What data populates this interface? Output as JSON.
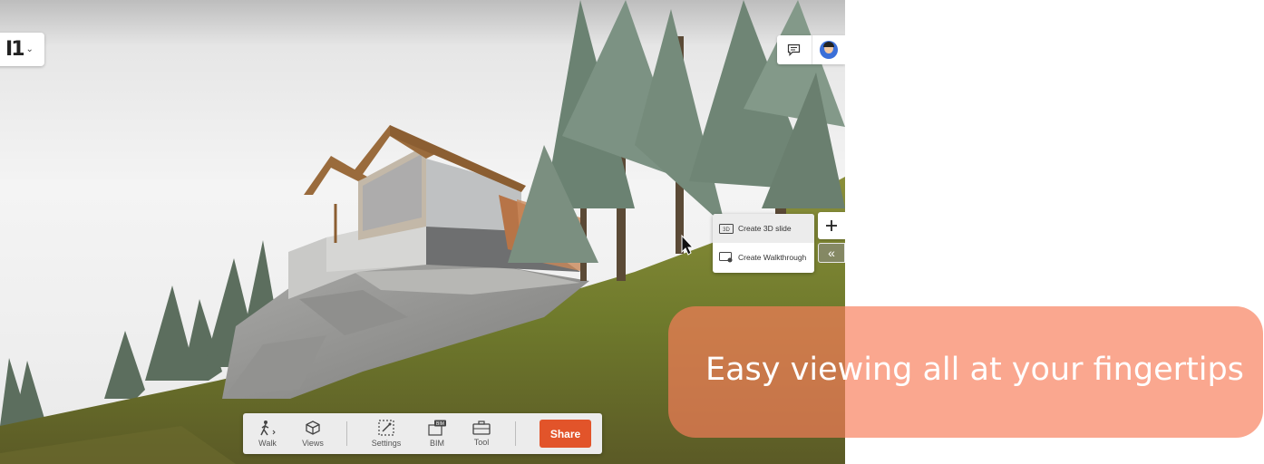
{
  "banner": {
    "text": "Easy viewing all at your fingertips"
  },
  "logo": {
    "mark": "I1"
  },
  "create_menu": {
    "create_slide": "Create 3D slide",
    "create_walkthrough": "Create  Walkthrough"
  },
  "toolbar": {
    "walk": "Walk",
    "views": "Views",
    "settings": "Settings",
    "bim": "BIM",
    "tool": "Tool",
    "share": "Share"
  },
  "colors": {
    "share_button": "#e2542a",
    "banner": "#f77e5a",
    "grass": "#6f7c2c"
  },
  "icons": [
    "app-logo-icon",
    "chevron-down-icon",
    "comment-icon",
    "avatar",
    "3d-slide-icon",
    "walkthrough-icon",
    "plus-icon",
    "double-chevron-left-icon",
    "walk-icon",
    "views-cube-icon",
    "settings-wand-icon",
    "bim-icon",
    "toolbox-icon",
    "mouse-cursor-icon"
  ]
}
